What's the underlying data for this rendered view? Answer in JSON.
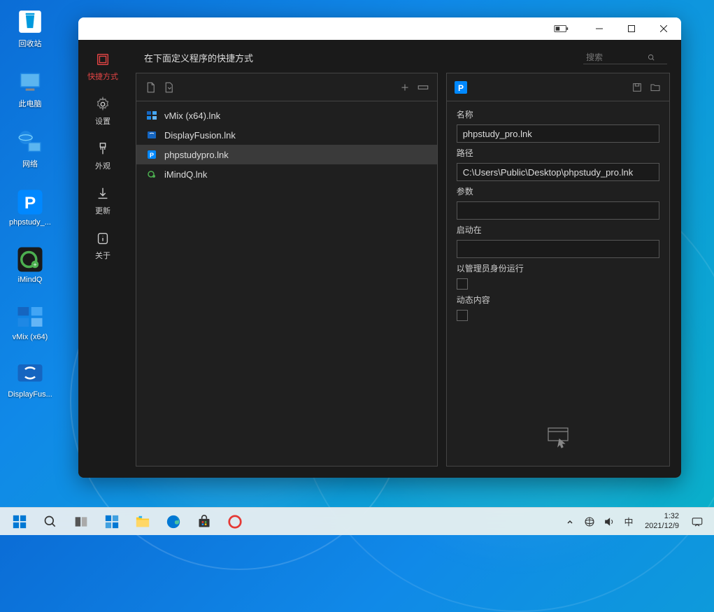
{
  "desktop": {
    "icons": [
      {
        "label": "回收站",
        "iconColor": "#fff"
      },
      {
        "label": "此电脑",
        "iconColor": "#1e88e5"
      },
      {
        "label": "网络",
        "iconColor": "#1e88e5"
      },
      {
        "label": "phpstudy_...",
        "iconColor": "#0088ff",
        "letter": "P"
      },
      {
        "label": "iMindQ",
        "iconColor": "#4caf50",
        "letter": "Q"
      },
      {
        "label": "vMix (x64)",
        "iconColor": "#1565c0"
      },
      {
        "label": "DisplayFus...",
        "iconColor": "#1565c0"
      }
    ]
  },
  "sidebar": {
    "items": [
      {
        "label": "快捷方式"
      },
      {
        "label": "设置"
      },
      {
        "label": "外观"
      },
      {
        "label": "更新"
      },
      {
        "label": "关于"
      }
    ]
  },
  "header": {
    "title": "在下面定义程序的快捷方式",
    "search_placeholder": "搜索"
  },
  "files": [
    {
      "name": "vMix (x64).lnk",
      "selected": false,
      "iconColor": "#1e88e5"
    },
    {
      "name": "DisplayFusion.lnk",
      "selected": false,
      "iconColor": "#1e88e5"
    },
    {
      "name": "phpstudypro.lnk",
      "selected": true,
      "iconColor": "#0088ff"
    },
    {
      "name": "iMindQ.lnk",
      "selected": false,
      "iconColor": "#4caf50"
    }
  ],
  "form": {
    "name_label": "名称",
    "name_value": "phpstudy_pro.lnk",
    "path_label": "路径",
    "path_value": "C:\\Users\\Public\\Desktop\\phpstudy_pro.lnk",
    "args_label": "参数",
    "args_value": "",
    "startin_label": "启动在",
    "startin_value": "",
    "admin_label": "以管理员身份运行",
    "dynamic_label": "动态内容"
  },
  "taskbar": {
    "time": "1:32",
    "date": "2021/12/9",
    "ime": "中"
  }
}
